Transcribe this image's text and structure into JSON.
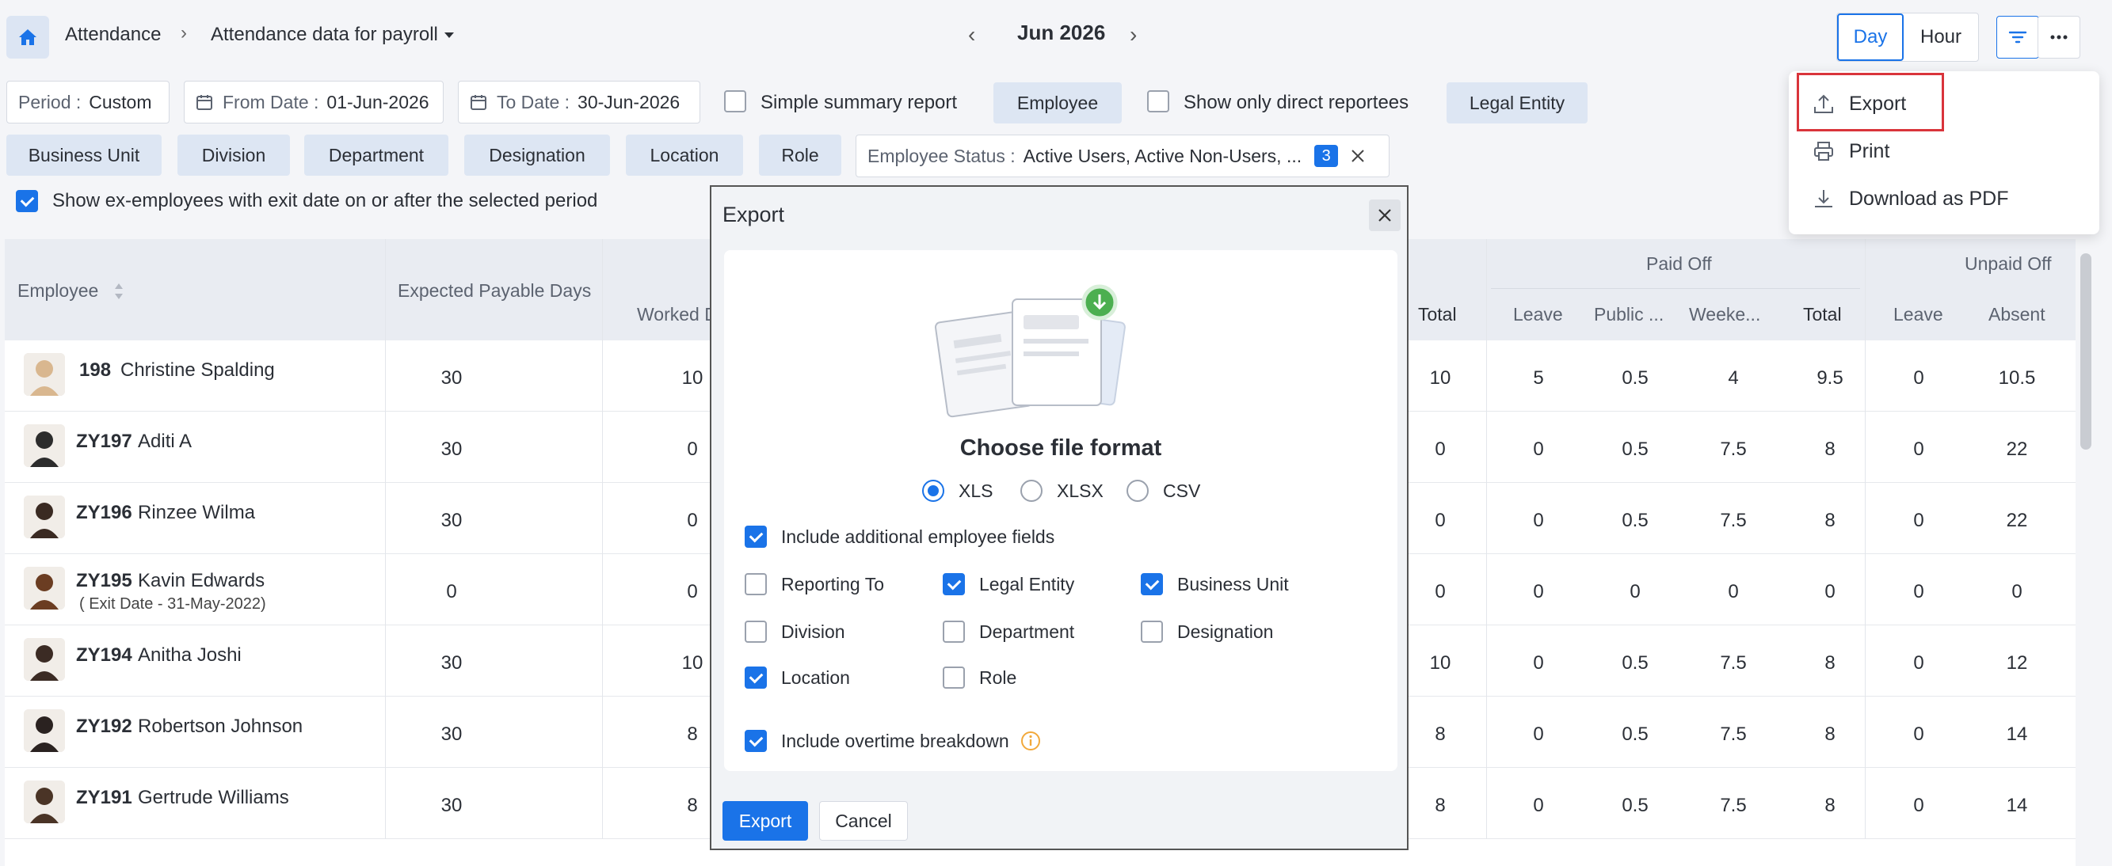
{
  "header": {
    "home_icon": "home-icon",
    "breadcrumb_root": "Attendance",
    "breadcrumb_current": "Attendance data for payroll",
    "month": "Jun 2026",
    "view_day": "Day",
    "view_hour": "Hour"
  },
  "filters": {
    "period_label": "Period :",
    "period_value": "Custom",
    "from_label": "From Date :",
    "from_value": "01-Jun-2026",
    "to_label": "To Date :",
    "to_value": "30-Jun-2026",
    "simple_summary": "Simple summary report",
    "employee_chip": "Employee",
    "direct_reportees": "Show only direct reportees",
    "legal_entity_chip": "Legal Entity",
    "chips": [
      "Business Unit",
      "Division",
      "Department",
      "Designation",
      "Location",
      "Role"
    ],
    "status_label": "Employee Status :",
    "status_value": "Active Users, Active Non-Users, ...",
    "status_count": "3",
    "show_ex_employees": "Show ex-employees with exit date on or after the selected period"
  },
  "menu": {
    "export": "Export",
    "print": "Print",
    "download_pdf": "Download as PDF"
  },
  "table": {
    "headers": {
      "employee": "Employee",
      "expected": "Expected Payable Days",
      "worked": "Worked D",
      "total1": "Total",
      "paid_off": "Paid Off",
      "leave": "Leave",
      "public": "Public ...",
      "weekend": "Weeke...",
      "total2": "Total",
      "unpaid_off": "Unpaid Off",
      "leave2": "Leave",
      "absent": "Absent"
    },
    "rows": [
      {
        "id": "198",
        "name": "Christine Spalding",
        "exit": "",
        "expected": "30",
        "worked": "10",
        "total1": "10",
        "leave": "5",
        "public": "0.5",
        "weekend": "4",
        "total2": "9.5",
        "uleave": "0",
        "absent": "10.5"
      },
      {
        "id": "ZY197",
        "name": "Aditi A",
        "exit": "",
        "expected": "30",
        "worked": "0",
        "total1": "0",
        "leave": "0",
        "public": "0.5",
        "weekend": "7.5",
        "total2": "8",
        "uleave": "0",
        "absent": "22"
      },
      {
        "id": "ZY196",
        "name": "Rinzee Wilma",
        "exit": "",
        "expected": "30",
        "worked": "0",
        "total1": "0",
        "leave": "0",
        "public": "0.5",
        "weekend": "7.5",
        "total2": "8",
        "uleave": "0",
        "absent": "22"
      },
      {
        "id": "ZY195",
        "name": "Kavin Edwards",
        "exit": "( Exit Date - 31-May-2022)",
        "expected": "0",
        "worked": "0",
        "total1": "0",
        "leave": "0",
        "public": "0",
        "weekend": "0",
        "total2": "0",
        "uleave": "0",
        "absent": "0"
      },
      {
        "id": "ZY194",
        "name": "Anitha Joshi",
        "exit": "",
        "expected": "30",
        "worked": "10",
        "total1": "10",
        "leave": "0",
        "public": "0.5",
        "weekend": "7.5",
        "total2": "8",
        "uleave": "0",
        "absent": "12"
      },
      {
        "id": "ZY192",
        "name": "Robertson Johnson",
        "exit": "",
        "expected": "30",
        "worked": "8",
        "total1": "8",
        "leave": "0",
        "public": "0.5",
        "weekend": "7.5",
        "total2": "8",
        "uleave": "0",
        "absent": "14"
      },
      {
        "id": "ZY191",
        "name": "Gertrude Williams",
        "exit": "",
        "expected": "30",
        "worked": "8",
        "total1": "8",
        "leave": "0",
        "public": "0.5",
        "weekend": "7.5",
        "total2": "8",
        "uleave": "0",
        "absent": "14"
      }
    ]
  },
  "modal": {
    "title": "Export",
    "choose_format": "Choose file format",
    "formats": [
      "XLS",
      "XLSX",
      "CSV"
    ],
    "include_fields": "Include additional employee fields",
    "fields": [
      "Reporting To",
      "Legal Entity",
      "Business Unit",
      "Division",
      "Department",
      "Designation",
      "Location",
      "Role"
    ],
    "include_overtime": "Include overtime breakdown",
    "export_button": "Export",
    "cancel_button": "Cancel"
  },
  "colors": {
    "accent": "#1a73e8",
    "chip": "#dde6f3",
    "highlight": "#d9343b"
  }
}
